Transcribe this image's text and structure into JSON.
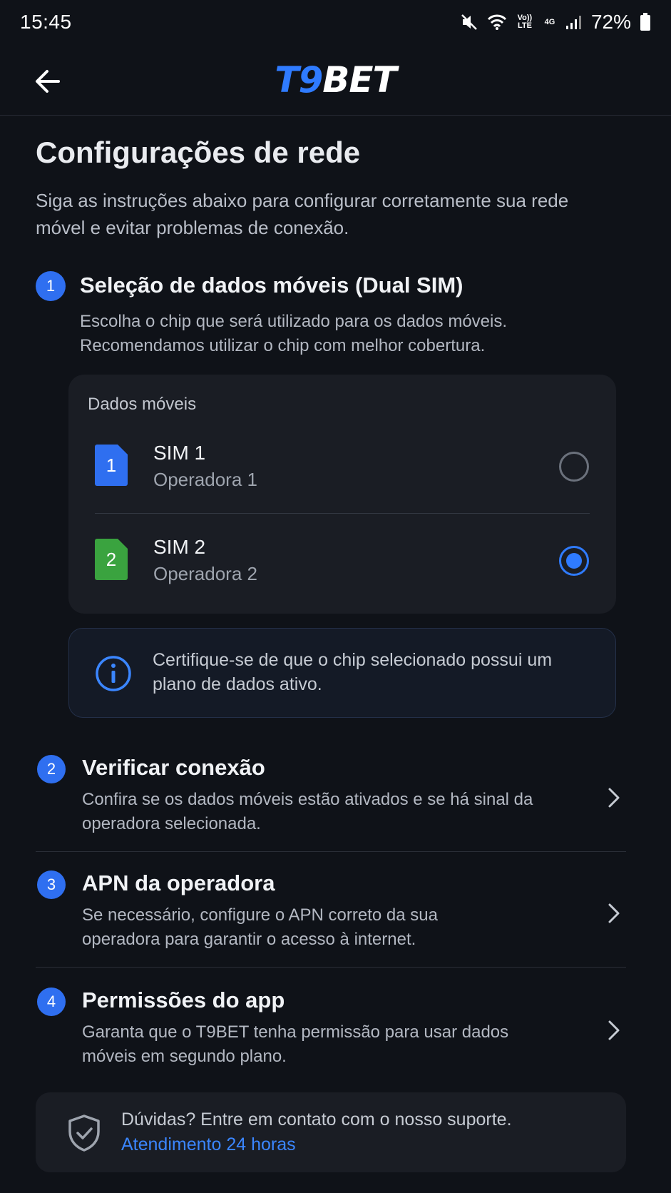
{
  "status_bar": {
    "time": "15:45",
    "volte_label": "Vo)) LTE",
    "network_label": "4G",
    "battery": "72%"
  },
  "header": {
    "logo_part1": "T9",
    "logo_part2": "BET",
    "back_icon": "arrow-left-icon"
  },
  "page": {
    "title": "Configurações de rede",
    "subtitle": "Siga as instruções abaixo para configurar corretamente sua rede móvel e evitar problemas de conexão."
  },
  "step1": {
    "number": "1",
    "title": "Seleção de dados móveis (Dual SIM)",
    "description": "Escolha o chip que será utilizado para os dados móveis. Recomendamos utilizar o chip com melhor cobertura.",
    "card_label": "Dados móveis",
    "sims": [
      {
        "badge": "1",
        "name": "SIM 1",
        "operator": "Operadora 1",
        "color": "#2f6ff0",
        "selected": false
      },
      {
        "badge": "2",
        "name": "SIM 2",
        "operator": "Operadora 2",
        "color": "#3aa33f",
        "selected": true
      }
    ],
    "info": "Certifique-se de que o chip selecionado possui um plano de dados ativo."
  },
  "steps": [
    {
      "number": "2",
      "title": "Verificar conexão",
      "description": "Confira se os dados móveis estão ativados e se há sinal da operadora selecionada."
    },
    {
      "number": "3",
      "title": "APN da operadora",
      "description": "Se necessário, configure o APN correto da sua operadora para garantir o acesso à internet."
    },
    {
      "number": "4",
      "title": "Permissões do app",
      "description": "Garanta que o T9BET tenha permissão para usar dados móveis em segundo plano."
    }
  ],
  "support": {
    "text": "Dúvidas? Entre em contato com o nosso suporte.",
    "link": "Atendimento 24 horas"
  },
  "colors": {
    "background": "#0f1218",
    "accent": "#2f7bff",
    "sim1": "#2f6ff0",
    "sim2": "#3aa33f"
  }
}
